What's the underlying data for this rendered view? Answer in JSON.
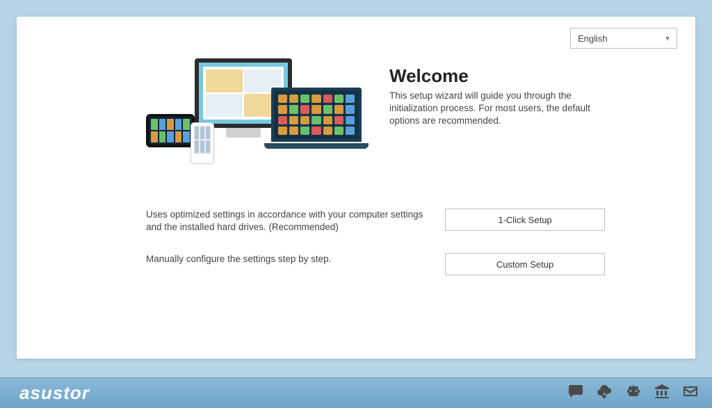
{
  "lang": {
    "selected": "English"
  },
  "hero": {
    "title": "Welcome",
    "desc": "This setup wizard will guide you through the initialization process. For most users, the default options are recommended."
  },
  "options": {
    "one_click": {
      "desc": "Uses optimized settings in accordance with your computer settings and the installed hard drives. (Recommended)",
      "button": "1-Click Setup"
    },
    "custom": {
      "desc": "Manually configure the settings step by step.",
      "button": "Custom Setup"
    }
  },
  "footer": {
    "brand": "asustor"
  }
}
